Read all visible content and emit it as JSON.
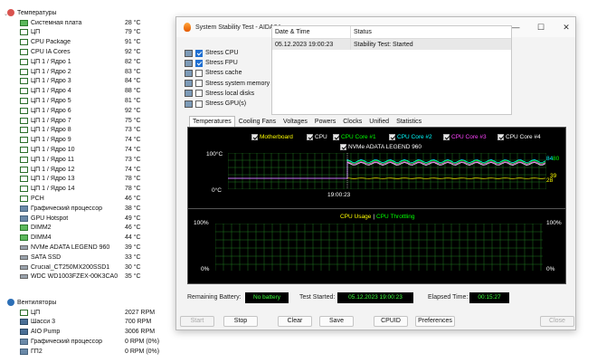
{
  "sensors": {
    "temps_title": "Температуры",
    "temps": [
      {
        "name": "Системная плата",
        "value": "28 °C",
        "icon": "mb"
      },
      {
        "name": "ЦП",
        "value": "79 °C",
        "icon": "chip"
      },
      {
        "name": "CPU Package",
        "value": "91 °C",
        "icon": "chip"
      },
      {
        "name": "CPU IA Cores",
        "value": "92 °C",
        "icon": "chip"
      },
      {
        "name": "ЦП 1 / Ядро 1",
        "value": "82 °C",
        "icon": "chip"
      },
      {
        "name": "ЦП 1 / Ядро 2",
        "value": "83 °C",
        "icon": "chip"
      },
      {
        "name": "ЦП 1 / Ядро 3",
        "value": "84 °C",
        "icon": "chip"
      },
      {
        "name": "ЦП 1 / Ядро 4",
        "value": "88 °C",
        "icon": "chip"
      },
      {
        "name": "ЦП 1 / Ядро 5",
        "value": "81 °C",
        "icon": "chip"
      },
      {
        "name": "ЦП 1 / Ядро 6",
        "value": "92 °C",
        "icon": "chip"
      },
      {
        "name": "ЦП 1 / Ядро 7",
        "value": "75 °C",
        "icon": "chip"
      },
      {
        "name": "ЦП 1 / Ядро 8",
        "value": "73 °C",
        "icon": "chip"
      },
      {
        "name": "ЦП 1 / Ядро 9",
        "value": "74 °C",
        "icon": "chip"
      },
      {
        "name": "ЦП 1 / Ядро 10",
        "value": "74 °C",
        "icon": "chip"
      },
      {
        "name": "ЦП 1 / Ядро 11",
        "value": "73 °C",
        "icon": "chip"
      },
      {
        "name": "ЦП 1 / Ядро 12",
        "value": "74 °C",
        "icon": "chip"
      },
      {
        "name": "ЦП 1 / Ядро 13",
        "value": "78 °C",
        "icon": "chip"
      },
      {
        "name": "ЦП 1 / Ядро 14",
        "value": "78 °C",
        "icon": "chip"
      },
      {
        "name": "PCH",
        "value": "46 °C",
        "icon": "chip"
      },
      {
        "name": "Графический процессор",
        "value": "38 °C",
        "icon": "dev"
      },
      {
        "name": "GPU Hotspot",
        "value": "49 °C",
        "icon": "dev"
      },
      {
        "name": "DIMM2",
        "value": "46 °C",
        "icon": "mb"
      },
      {
        "name": "DIMM4",
        "value": "44 °C",
        "icon": "mb"
      },
      {
        "name": "NVMe ADATA LEGEND 960",
        "value": "39 °C",
        "icon": "drv"
      },
      {
        "name": "SATA SSD",
        "value": "33 °C",
        "icon": "drv"
      },
      {
        "name": "Crucial_CT250MX200SSD1",
        "value": "30 °C",
        "icon": "drv"
      },
      {
        "name": "WDC WD1003FZEX-00K3CA0",
        "value": "35 °C",
        "icon": "drv"
      }
    ],
    "fans_title": "Вентиляторы",
    "fans": [
      {
        "name": "ЦП",
        "value": "2027 RPM",
        "icon": "chip"
      },
      {
        "name": "Шасси 3",
        "value": "700 RPM",
        "icon": "fan"
      },
      {
        "name": "AIO Pump",
        "value": "3006 RPM",
        "icon": "fan"
      },
      {
        "name": "Графический процессор",
        "value": "0 RPM  (0%)",
        "icon": "dev"
      },
      {
        "name": "ГП2",
        "value": "0 RPM  (0%)",
        "icon": "dev"
      }
    ]
  },
  "window": {
    "title": "System Stability Test - AIDA64",
    "minimize": "—",
    "maximize": "☐",
    "close": "✕"
  },
  "stress_options": [
    {
      "label": "Stress CPU",
      "checked": true,
      "icon": "cpu-icon"
    },
    {
      "label": "Stress FPU",
      "checked": true,
      "icon": "fpu-icon"
    },
    {
      "label": "Stress cache",
      "checked": false,
      "icon": "cache-icon"
    },
    {
      "label": "Stress system memory",
      "checked": false,
      "icon": "memory-icon"
    },
    {
      "label": "Stress local disks",
      "checked": false,
      "icon": "disk-icon"
    },
    {
      "label": "Stress GPU(s)",
      "checked": false,
      "icon": "gpu-icon"
    }
  ],
  "status_table": {
    "col_date": "Date & Time",
    "col_status": "Status",
    "rows": [
      {
        "date": "05.12.2023 19:00:23",
        "status": "Stability Test: Started"
      }
    ]
  },
  "tabs": [
    "Temperatures",
    "Cooling Fans",
    "Voltages",
    "Powers",
    "Clocks",
    "Unified",
    "Statistics"
  ],
  "temp_graph": {
    "legend": [
      {
        "label": "Motherboard",
        "color": "#ffff00"
      },
      {
        "label": "CPU",
        "color": "#ffffff"
      },
      {
        "label": "CPU Core #1",
        "color": "#00ff00"
      },
      {
        "label": "CPU Core #2",
        "color": "#00ffff"
      },
      {
        "label": "CPU Core #3",
        "color": "#ff44ff"
      },
      {
        "label": "CPU Core #4",
        "color": "#ffffff"
      },
      {
        "label": "NVMe ADATA LEGEND 960",
        "color": "#ffffff"
      }
    ],
    "y_top": "100°C",
    "y_bottom": "0°C",
    "x_label": "19:00:23",
    "right_values": [
      "84",
      "80",
      "39",
      "28"
    ]
  },
  "usage_graph": {
    "legend_a": "CPU Usage",
    "sep": "|",
    "legend_b": "CPU Throttling",
    "y_top_left": "100%",
    "y_bottom_left": "0%",
    "y_top_right": "100%",
    "y_bottom_right": "0%"
  },
  "info": {
    "battery_label": "Remaining Battery:",
    "battery_value": "No battery",
    "started_label": "Test Started:",
    "started_value": "05.12.2023 19:00:23",
    "elapsed_label": "Elapsed Time:",
    "elapsed_value": "00:15:27"
  },
  "buttons": {
    "start": "Start",
    "stop": "Stop",
    "clear": "Clear",
    "save": "Save",
    "cpuid": "CPUID",
    "preferences": "Preferences",
    "close": "Close"
  }
}
